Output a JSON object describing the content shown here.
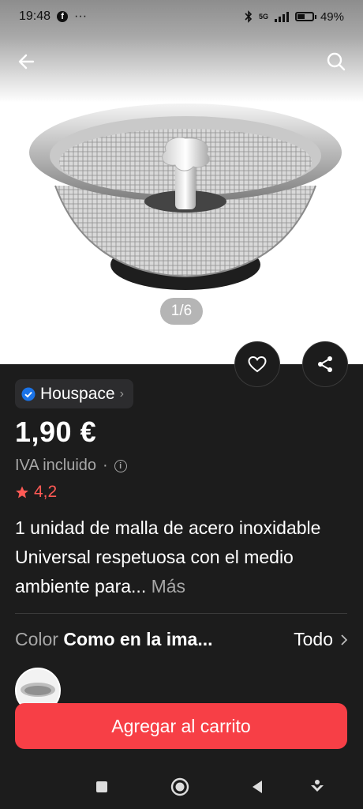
{
  "status_bar": {
    "time": "19:48",
    "dots": "···",
    "network": "5G",
    "battery": "49%"
  },
  "image": {
    "pager": "1/6"
  },
  "store": {
    "name": "Houspace"
  },
  "product": {
    "price": "1,90 €",
    "tax_note": "IVA incluido",
    "tax_sep": "·",
    "rating": "4,2",
    "title": "1 unidad de malla de acero inoxidable Universal respetuosa con el medio ambiente para...",
    "more": "Más"
  },
  "variant": {
    "label": "Color",
    "value": "Como en la ima...",
    "all": "Todo"
  },
  "actions": {
    "cart": "Agregar al carrito"
  },
  "colors": {
    "accent": "#f73f46",
    "rating": "#ff5a55",
    "verified": "#1a73e8"
  }
}
